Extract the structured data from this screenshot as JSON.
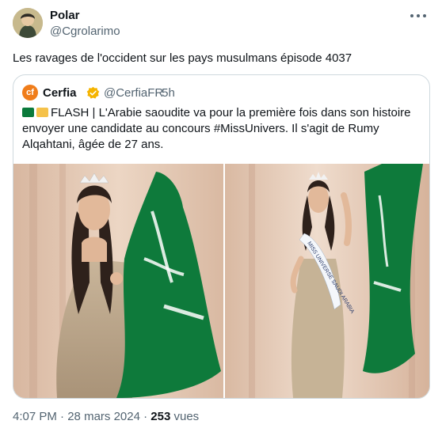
{
  "author": {
    "name": "Polar",
    "handle": "@Cgrolarimo"
  },
  "tweet": {
    "text": "Les ravages de l'occident sur les pays musulmans épisode 4037"
  },
  "quoted": {
    "avatar_letter": "cf",
    "name": "Cerfia",
    "handle": "@CerfiaFR",
    "time": "· 5h",
    "text": "FLASH | L'Arabie saoudite va pour la première fois dans son histoire envoyer une candidate au concours #MissUnivers. Il s'agit de Rumy Alqahtani, âgée de 27 ans.",
    "sash_text": "MISS UNIVERSE SAUDI ARABIA"
  },
  "meta": {
    "time": "4:07 PM",
    "date": "28 mars 2024",
    "sep": "·",
    "views": "253",
    "views_label": "vues"
  },
  "colors": {
    "flag_green": "#0e7a3b",
    "verified": "#f5b400",
    "muted": "#536471"
  }
}
